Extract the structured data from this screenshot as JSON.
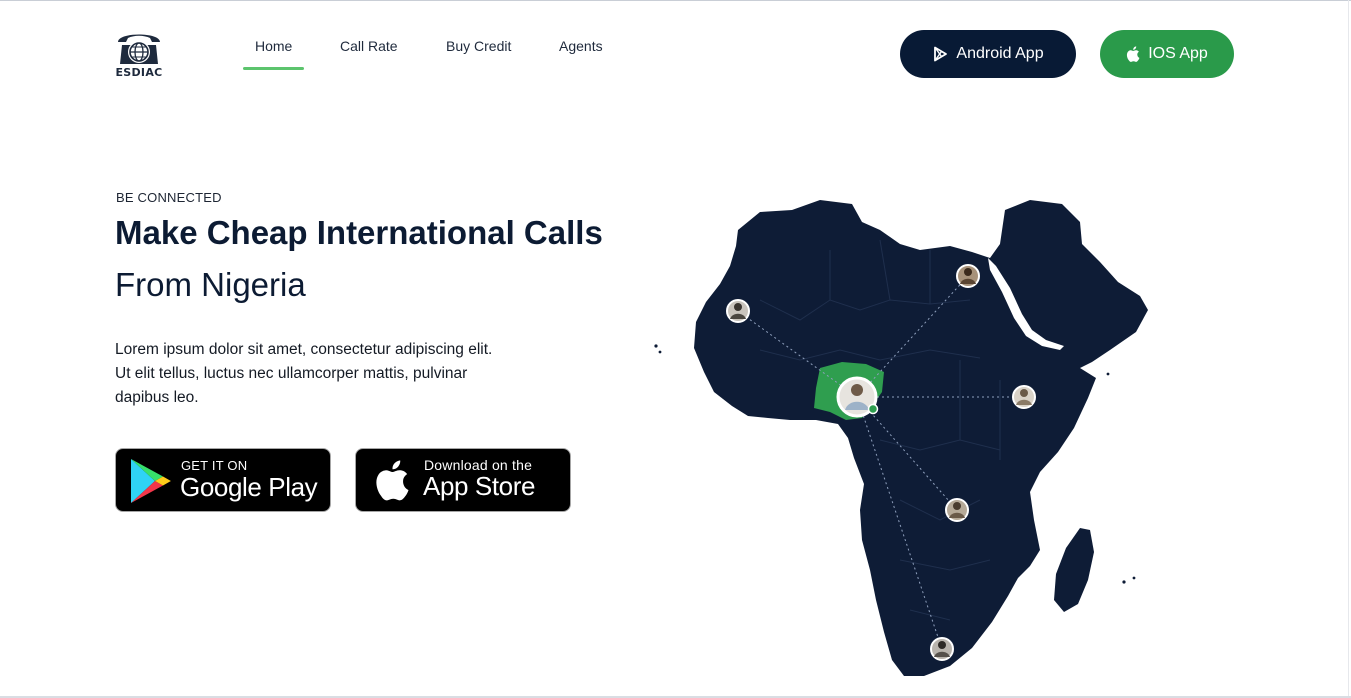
{
  "brand": {
    "name": "ESDIAC"
  },
  "nav": {
    "items": [
      {
        "label": "Home",
        "active": true
      },
      {
        "label": "Call Rate",
        "active": false
      },
      {
        "label": "Buy Credit",
        "active": false
      },
      {
        "label": "Agents",
        "active": false
      }
    ]
  },
  "header_buttons": {
    "android": {
      "label": "Android App",
      "icon": "play-store-icon"
    },
    "ios": {
      "label": "IOS App",
      "icon": "apple-icon"
    }
  },
  "hero": {
    "eyebrow": "BE CONNECTED",
    "headline": "Make Cheap International Calls",
    "subheadline": "From Nigeria",
    "lead": "Lorem ipsum dolor sit amet, consectetur adipiscing elit. Ut elit tellus, luctus nec ullamcorper mattis, pulvinar dapibus leo."
  },
  "badges": {
    "google": {
      "small": "GET IT ON",
      "big": "Google Play",
      "icon": "google-play-icon"
    },
    "apple": {
      "small": "Download on the",
      "big": "App Store",
      "icon": "apple-icon"
    }
  },
  "colors": {
    "navy": "#081a35",
    "green": "#2a9a4a",
    "nav_active": "#5cc46d",
    "map": "#0e1c36",
    "highlight": "#2f9e4f"
  }
}
